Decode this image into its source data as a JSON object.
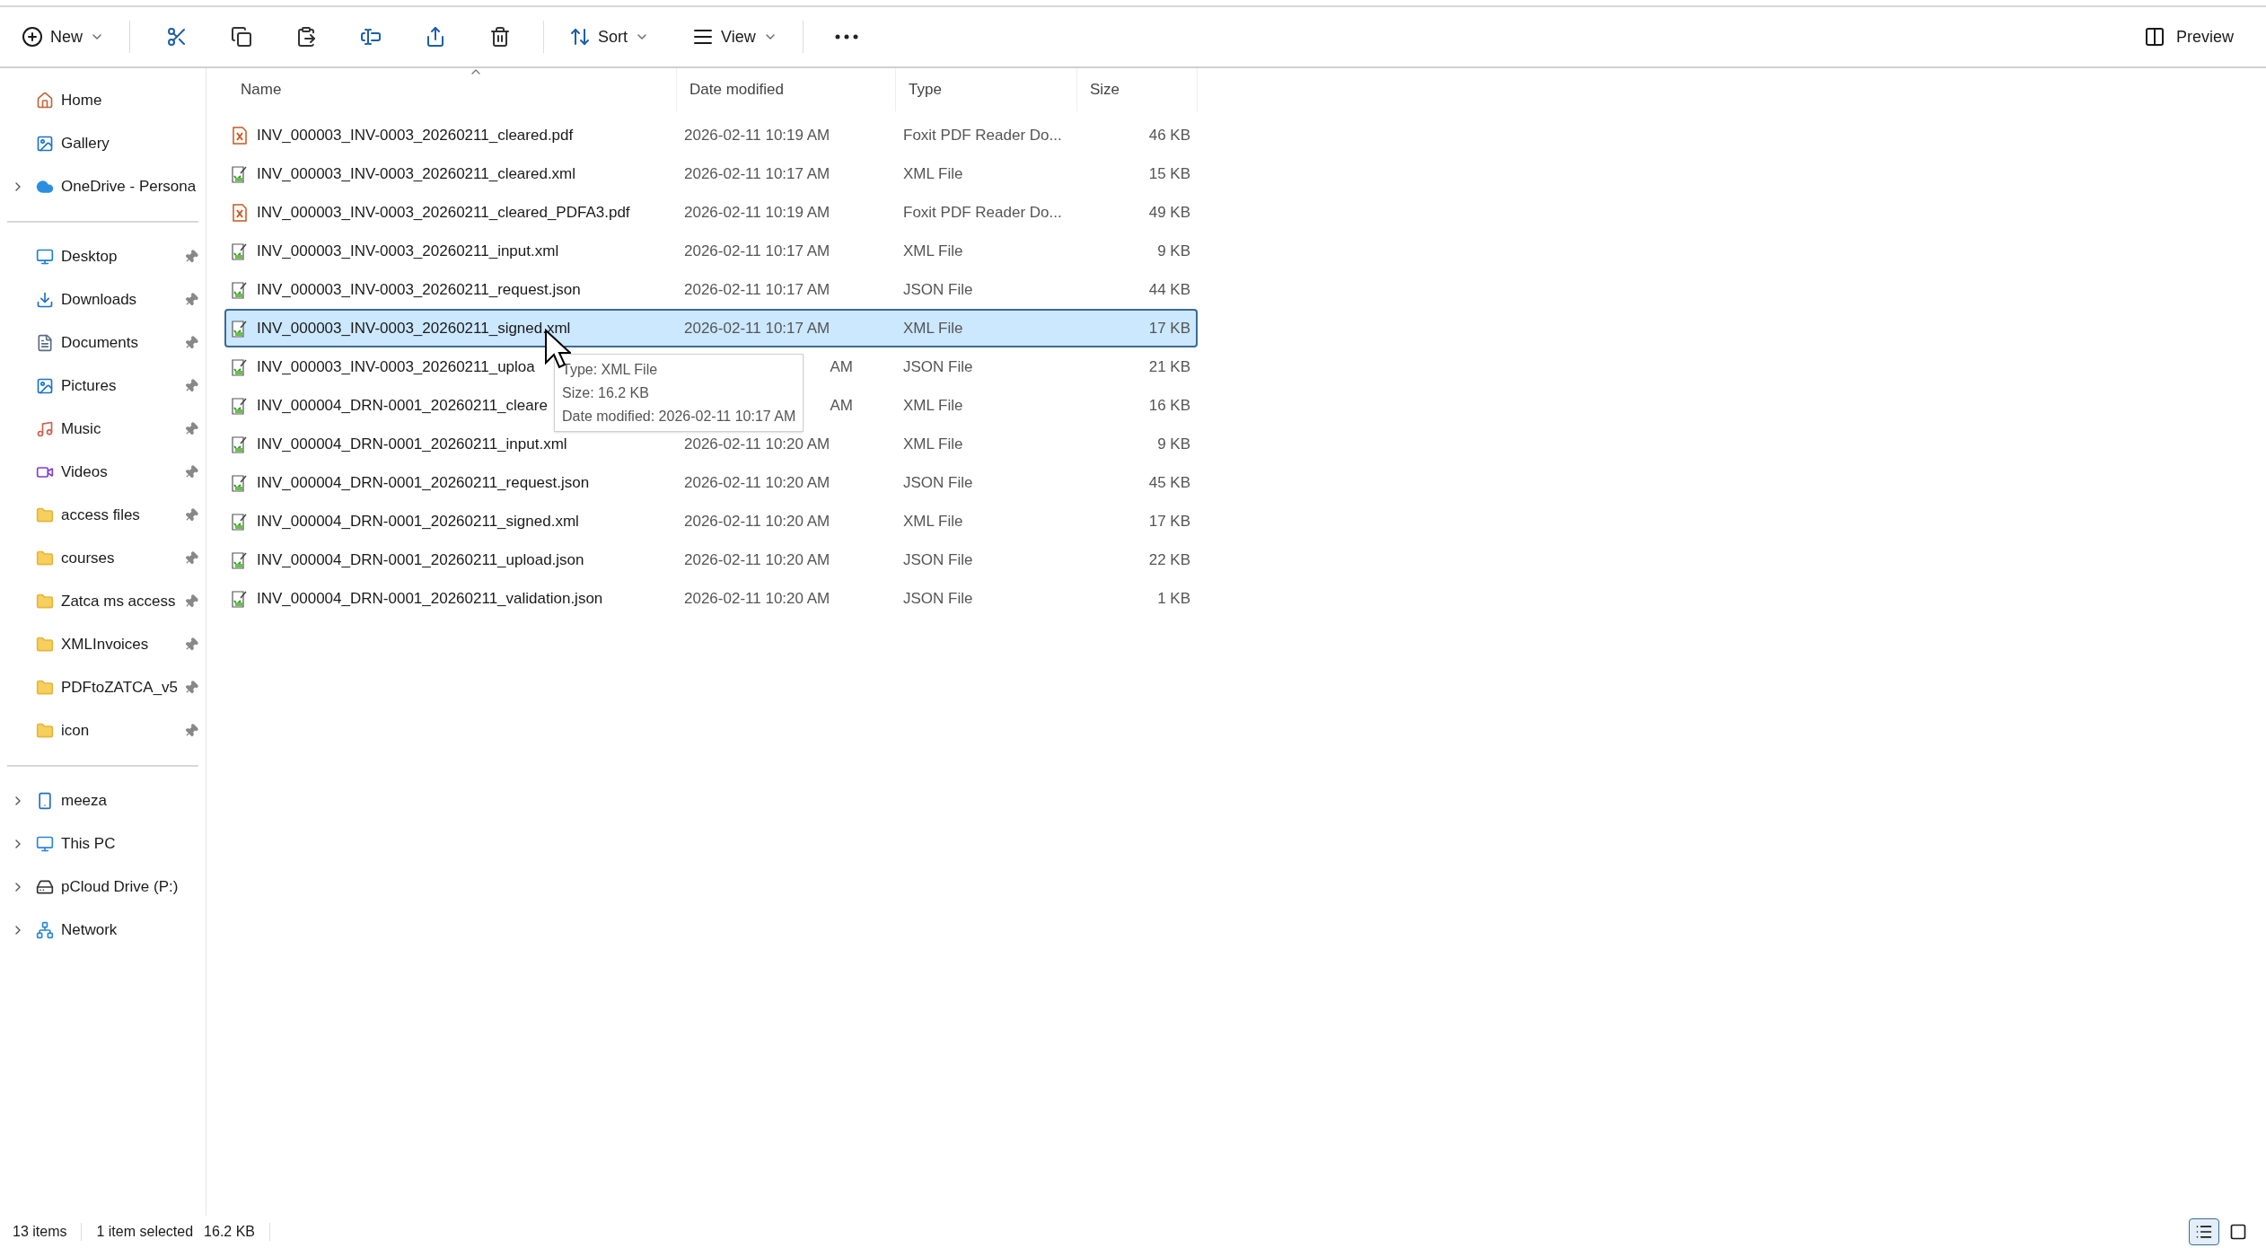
{
  "toolbar": {
    "new_label": "New",
    "sort_label": "Sort",
    "view_label": "View",
    "preview_label": "Preview"
  },
  "sidebar": {
    "sections": [
      [
        {
          "label": "Home",
          "expandable": false,
          "pinned": false
        },
        {
          "label": "Gallery",
          "expandable": false,
          "pinned": false
        },
        {
          "label": "OneDrive - Persona",
          "expandable": true,
          "pinned": false
        }
      ],
      [
        {
          "label": "Desktop",
          "expandable": false,
          "pinned": true
        },
        {
          "label": "Downloads",
          "expandable": false,
          "pinned": true
        },
        {
          "label": "Documents",
          "expandable": false,
          "pinned": true
        },
        {
          "label": "Pictures",
          "expandable": false,
          "pinned": true
        },
        {
          "label": "Music",
          "expandable": false,
          "pinned": true
        },
        {
          "label": "Videos",
          "expandable": false,
          "pinned": true
        },
        {
          "label": "access files",
          "expandable": false,
          "pinned": true
        },
        {
          "label": "courses",
          "expandable": false,
          "pinned": true
        },
        {
          "label": "Zatca ms access",
          "expandable": false,
          "pinned": true
        },
        {
          "label": "XMLInvoices",
          "expandable": false,
          "pinned": true
        },
        {
          "label": "PDFtoZATCA_v5",
          "expandable": false,
          "pinned": true
        },
        {
          "label": "icon",
          "expandable": false,
          "pinned": true
        }
      ],
      [
        {
          "label": "meeza",
          "expandable": true,
          "pinned": false
        },
        {
          "label": "This PC",
          "expandable": true,
          "pinned": false
        },
        {
          "label": "pCloud Drive (P:)",
          "expandable": true,
          "pinned": false
        },
        {
          "label": "Network",
          "expandable": true,
          "pinned": false
        }
      ]
    ]
  },
  "table": {
    "columns": [
      "Name",
      "Date modified",
      "Type",
      "Size"
    ],
    "rows": [
      {
        "name": "INV_000003_INV-0003_20260211_cleared.pdf",
        "date": "2026-02-11 10:19 AM",
        "type": "Foxit PDF Reader Do...",
        "size": "46 KB",
        "kind": "pdf",
        "selected": false,
        "covered": false
      },
      {
        "name": "INV_000003_INV-0003_20260211_cleared.xml",
        "date": "2026-02-11 10:17 AM",
        "type": "XML File",
        "size": "15 KB",
        "kind": "text",
        "selected": false,
        "covered": false
      },
      {
        "name": "INV_000003_INV-0003_20260211_cleared_PDFA3.pdf",
        "date": "2026-02-11 10:19 AM",
        "type": "Foxit PDF Reader Do...",
        "size": "49 KB",
        "kind": "pdf",
        "selected": false,
        "covered": false
      },
      {
        "name": "INV_000003_INV-0003_20260211_input.xml",
        "date": "2026-02-11 10:17 AM",
        "type": "XML File",
        "size": "9 KB",
        "kind": "text",
        "selected": false,
        "covered": false
      },
      {
        "name": "INV_000003_INV-0003_20260211_request.json",
        "date": "2026-02-11 10:17 AM",
        "type": "JSON File",
        "size": "44 KB",
        "kind": "text",
        "selected": false,
        "covered": false
      },
      {
        "name": "INV_000003_INV-0003_20260211_signed.xml",
        "date": "2026-02-11 10:17 AM",
        "type": "XML File",
        "size": "17 KB",
        "kind": "text",
        "selected": true,
        "covered": false
      },
      {
        "name": "INV_000003_INV-0003_20260211_uploa",
        "date": "AM",
        "type": "JSON File",
        "size": "21 KB",
        "kind": "text",
        "selected": false,
        "covered": true
      },
      {
        "name": "INV_000004_DRN-0001_20260211_cleare",
        "date": "AM",
        "type": "XML File",
        "size": "16 KB",
        "kind": "text",
        "selected": false,
        "covered": true
      },
      {
        "name": "INV_000004_DRN-0001_20260211_input.xml",
        "date": "2026-02-11 10:20 AM",
        "type": "XML File",
        "size": "9 KB",
        "kind": "text",
        "selected": false,
        "covered": false
      },
      {
        "name": "INV_000004_DRN-0001_20260211_request.json",
        "date": "2026-02-11 10:20 AM",
        "type": "JSON File",
        "size": "45 KB",
        "kind": "text",
        "selected": false,
        "covered": false
      },
      {
        "name": "INV_000004_DRN-0001_20260211_signed.xml",
        "date": "2026-02-11 10:20 AM",
        "type": "XML File",
        "size": "17 KB",
        "kind": "text",
        "selected": false,
        "covered": false
      },
      {
        "name": "INV_000004_DRN-0001_20260211_upload.json",
        "date": "2026-02-11 10:20 AM",
        "type": "JSON File",
        "size": "22 KB",
        "kind": "text",
        "selected": false,
        "covered": false
      },
      {
        "name": "INV_000004_DRN-0001_20260211_validation.json",
        "date": "2026-02-11 10:20 AM",
        "type": "JSON File",
        "size": "1 KB",
        "kind": "text",
        "selected": false,
        "covered": false
      }
    ]
  },
  "tooltip": {
    "lines": [
      "Type: XML File",
      "Size: 16.2 KB",
      "Date modified: 2026-02-11 10:17 AM"
    ]
  },
  "status_bar": {
    "count": "13 items",
    "selection": "1 item selected",
    "selection_size": "16.2 KB",
    "views": [
      {
        "kind": "details",
        "selected": true
      },
      {
        "kind": "tiles",
        "selected": false
      }
    ]
  }
}
